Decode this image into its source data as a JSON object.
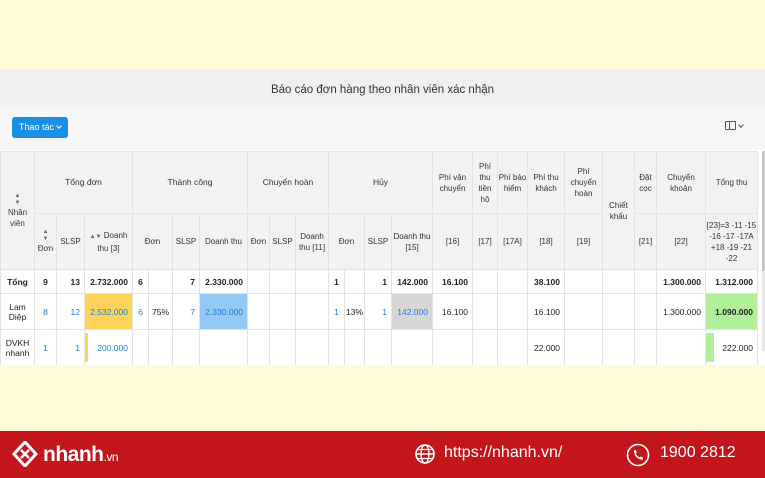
{
  "report": {
    "title": "Báo cáo đơn hàng theo nhân viên xác nhận",
    "action_button": "Thao tác"
  },
  "columns": {
    "employee": "Nhân viên",
    "total_orders": "Tổng đơn",
    "success": "Thành công",
    "returned": "Chuyển hoàn",
    "cancelled": "Hủy",
    "shipping_fee": "Phí vận chuyển",
    "cod_fee": "Phí thu tiền hộ",
    "insurance_fee": "Phí bảo hiểm",
    "customer_fee": "Phí thu khách",
    "return_fee": "Phí chuyển hoàn",
    "discount": "Chiết khấu",
    "deposit": "Đặt cọc",
    "transfer": "Chuyển khoản",
    "total_collect": "Tổng thu",
    "sub_don": "Đơn",
    "sub_slsp": "SLSP",
    "sub_revenue": "Doanh thu",
    "sub_revenue_3": "Doanh thu [3]",
    "sub_revenue_11": "Doanh thu [11]",
    "sub_revenue_15": "Doanh thu [15]",
    "code_16": "[16]",
    "code_17": "[17]",
    "code_17a": "[17A]",
    "code_18": "[18]",
    "code_19": "[19]",
    "code_21": "[21]",
    "code_22": "[22]",
    "formula": "[23]=3 -11 -15 -16 -17 -17A +18 -19 -21 -22"
  },
  "rows": {
    "total": {
      "name": "Tổng",
      "orders": "9",
      "slsp": "13",
      "revenue": "2.732.000",
      "s_orders": "6",
      "s_slsp": "7",
      "s_revenue": "2.330.000",
      "c_orders": "1",
      "c_slsp": "1",
      "c_revenue": "142.000",
      "shipping": "16.100",
      "customer_fee": "38.100",
      "transfer": "1.300.000",
      "total": "1.312.000"
    },
    "lam": {
      "name": "Lam Diệp",
      "orders": "8",
      "slsp": "12",
      "revenue": "2.532.000",
      "s_orders": "6",
      "s_pct": "75%",
      "s_slsp": "7",
      "s_revenue": "2.330.000",
      "c_orders": "1",
      "c_pct": "13%",
      "c_slsp": "1",
      "c_revenue": "142.000",
      "shipping": "16.100",
      "customer_fee": "16.100",
      "transfer": "1.300.000",
      "total": "1.090.000"
    },
    "dvkh": {
      "name": "DVKH nhanh",
      "orders": "1",
      "slsp": "1",
      "revenue": "200.000",
      "customer_fee": "22.000",
      "total": "222.000"
    }
  },
  "footer": {
    "brand": "nhanh",
    "brand_suffix": ".vn",
    "website": "https://nhanh.vn/",
    "phone": "1900 2812"
  },
  "colors": {
    "primary": "#1a8fe3",
    "orange": "#fdd35b",
    "light_blue": "#94c8f5",
    "grey": "#d6d6d6",
    "green": "#b1ef9a",
    "footer_red": "#c3161c"
  },
  "icons": [
    "chevron-down-icon",
    "column-settings-icon",
    "sort-icon",
    "globe-icon",
    "phone-icon",
    "nhanh-logo-icon"
  ]
}
